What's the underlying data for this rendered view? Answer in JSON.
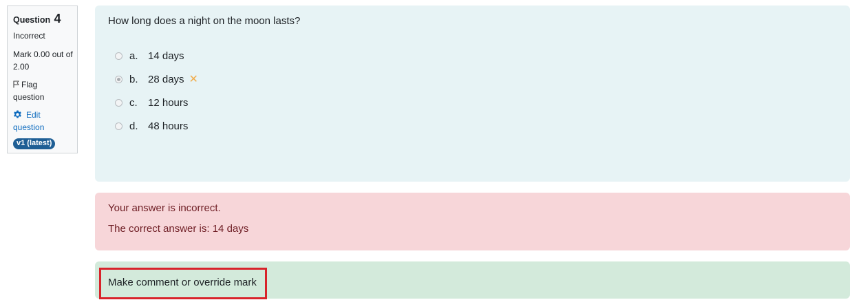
{
  "info": {
    "question_label": "Question",
    "question_number": "4",
    "state": "Incorrect",
    "grade_line1": "Mark 0.00 out of",
    "grade_line2": "2.00",
    "flag_line1": "Flag",
    "flag_line2": "question",
    "edit_line1": "Edit",
    "edit_line2": "question",
    "version_badge": "v1 (latest)"
  },
  "question": {
    "text": "How long does a night on the moon lasts?",
    "answers": [
      {
        "letter": "a.",
        "text": "14 days",
        "selected": false
      },
      {
        "letter": "b.",
        "text": "28 days",
        "selected": true,
        "mark": "✕"
      },
      {
        "letter": "c.",
        "text": "12 hours",
        "selected": false
      },
      {
        "letter": "d.",
        "text": "48 hours",
        "selected": false
      }
    ]
  },
  "feedback": {
    "line1": "Your answer is incorrect.",
    "line2": "The correct answer is: 14 days"
  },
  "comment": {
    "link_label": "Make comment or override mark"
  },
  "colors": {
    "formulation_bg": "#e7f3f5",
    "feedback_bg": "#f7d6d9",
    "comment_bg": "#d3eadb",
    "highlight_border": "#d8232a",
    "badge_bg": "#1f5f95",
    "wrong_mark": "#f0ad4e"
  },
  "icons": {
    "flag": "flag-icon",
    "edit": "gear-icon",
    "wrong": "cross-icon"
  }
}
